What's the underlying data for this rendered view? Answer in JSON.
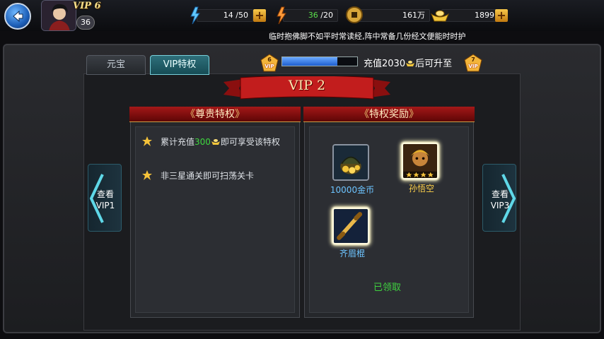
{
  "header": {
    "vip_label": "VIP 6",
    "player_level": "36",
    "stamina": {
      "value": "14",
      "max": "/50",
      "icon": "stamina-icon"
    },
    "energy": {
      "value": "36",
      "max": "/20",
      "icon": "energy-icon"
    },
    "coins": {
      "value": "161万",
      "icon": "coin-icon"
    },
    "ingots": {
      "value": "1899",
      "icon": "ingot-icon"
    },
    "ticker": "临时抱佛脚不如平时常读经,阵中常备几份经文便能时时护"
  },
  "tabs": [
    {
      "label": "元宝",
      "active": false
    },
    {
      "label": "VIP特权",
      "active": true
    }
  ],
  "vip_progress": {
    "current_level": "6",
    "next_level": "7",
    "vip_text": "VIP",
    "fill_fraction": 0.74,
    "text_prefix": "充值2030",
    "text_suffix": "后可升至"
  },
  "page_title": "VIP 2",
  "privileges_panel": {
    "title": "尊贵特权",
    "items": [
      {
        "prefix": "累计充值",
        "highlight": "300",
        "suffix": "即可享受该特权"
      },
      {
        "prefix": "非三星通关即可扫荡关卡",
        "highlight": "",
        "suffix": ""
      }
    ]
  },
  "rewards_panel": {
    "title": "特权奖励",
    "rewards": [
      {
        "name": "10000金币",
        "icon": "gold-bag-icon"
      },
      {
        "name": "孙悟空",
        "icon": "sun-wukong-portrait-icon",
        "stars": 4
      },
      {
        "name": "齐眉棍",
        "icon": "staff-icon"
      }
    ],
    "status": "已领取"
  },
  "nav": {
    "prev": {
      "line1": "查看",
      "line2": "VIP1"
    },
    "next": {
      "line1": "查看",
      "line2": "VIP3"
    }
  },
  "colors": {
    "accent_green": "#3fd23f",
    "reward_name_blue": "#6dc4ff",
    "ribbon_red": "#a51818"
  }
}
